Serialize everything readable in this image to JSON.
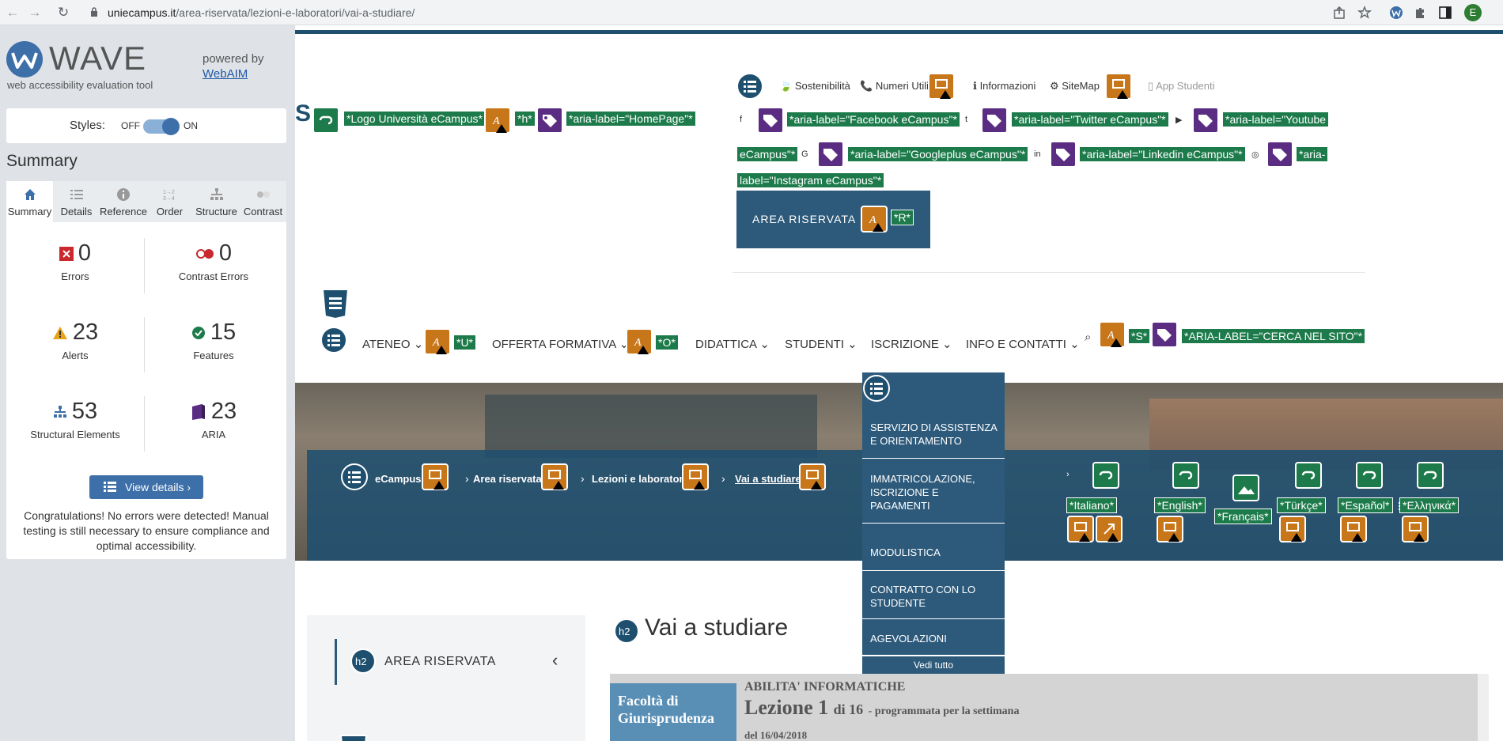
{
  "browser": {
    "url_host": "uniecampus.it",
    "url_path": "/area-riservata/lezioni-e-laboratori/vai-a-studiare/",
    "profile_initial": "E"
  },
  "wave": {
    "logo_word": "WAVE",
    "subtitle": "web accessibility evaluation tool",
    "powered_by": "powered by",
    "webaim": "WebAIM",
    "styles_label": "Styles:",
    "styles_off": "OFF",
    "styles_on": "ON",
    "summary_title": "Summary",
    "tabs": [
      {
        "label": "Summary",
        "icon": "home-icon"
      },
      {
        "label": "Details",
        "icon": "list-icon"
      },
      {
        "label": "Reference",
        "icon": "info-icon"
      },
      {
        "label": "Order",
        "icon": "order-icon"
      },
      {
        "label": "Structure",
        "icon": "structure-icon"
      },
      {
        "label": "Contrast",
        "icon": "contrast-icon"
      }
    ],
    "stats": {
      "errors": {
        "value": "0",
        "label": "Errors"
      },
      "contrast_errors": {
        "value": "0",
        "label": "Contrast Errors"
      },
      "alerts": {
        "value": "23",
        "label": "Alerts"
      },
      "features": {
        "value": "15",
        "label": "Features"
      },
      "structural": {
        "value": "53",
        "label": "Structural Elements"
      },
      "aria": {
        "value": "23",
        "label": "ARIA"
      }
    },
    "view_details": "View details ›",
    "congrats": "Congratulations! No errors were detected! Manual testing is still necessary to ensure compliance and optimal accessibility."
  },
  "site": {
    "logo_fragment": "S",
    "logo_tag": "*Logo Università eCampus*",
    "h_tag": "*h*",
    "homepage_tag": "*aria-label=\"HomePage\"*",
    "top_links": {
      "sostenibilita": "Sostenibilità",
      "numeri": "Numeri Utili",
      "informazioni": "Informazioni",
      "sitemap": "SiteMap",
      "app": "App Studenti"
    },
    "social_tags": {
      "facebook": "*aria-label=\"Facebook eCampus\"*",
      "twitter": "*aria-label=\"Twitter eCampus\"*",
      "youtube_a": "*aria-label=\"Youtube",
      "youtube_b": "eCampus\"*",
      "googleplus": "*aria-label=\"Googleplus eCampus\"*",
      "linkedin": "*aria-label=\"Linkedin eCampus\"*",
      "instagram_a": "*aria-",
      "instagram_b": "label=\"Instagram eCampus\"*"
    },
    "area_riservata": "AREA RISERVATA",
    "r_tag": "*R*",
    "menu": {
      "ateneo": "ATENEO",
      "u_tag": "*U*",
      "offerta": "OFFERTA FORMATIVA",
      "o_tag": "*O*",
      "didattica": "DIDATTICA",
      "studenti": "STUDENTI",
      "iscrizione": "ISCRIZIONE",
      "info": "INFO E CONTATTI",
      "s_tag": "*S*",
      "search_tag": "*ARIA-LABEL=\"CERCA NEL SITO\"*"
    },
    "breadcrumb": [
      "eCampus",
      "Area riservata",
      "Lezioni e laboratori",
      "Vai a studiare"
    ],
    "dropdown": {
      "items": [
        "SERVIZIO DI ASSISTENZA E ORIENTAMENTO",
        "IMMATRICOLAZIONE, ISCRIZIONE E PAGAMENTI",
        "MODULISTICA",
        "CONTRATTO CON LO STUDENTE",
        "AGEVOLAZIONI"
      ],
      "more": "Vedi tutto"
    },
    "languages": [
      "*Italiano*",
      "*English*",
      "*Français*",
      "*Türkçe*",
      "*Español*",
      "*Ελληνικά*"
    ],
    "side_title": "AREA RISERVATA",
    "h2_badge": "h2",
    "page_title": "Vai a studiare",
    "lesson": {
      "faculty": "Facoltà di Giurisprudenza",
      "category": "ABILITA' INFORMATICHE",
      "lesson_word": "Lezione 1",
      "of": "di 16",
      "schedule": "- programmata per la settimana",
      "date": "del 16/04/2018"
    }
  },
  "colors": {
    "wave_blue": "#3d6fa8",
    "site_blue": "#2d5a7b",
    "tag_green": "#1d7b4b",
    "alert_orange": "#c8761a",
    "aria_purple": "#5b2d82"
  }
}
